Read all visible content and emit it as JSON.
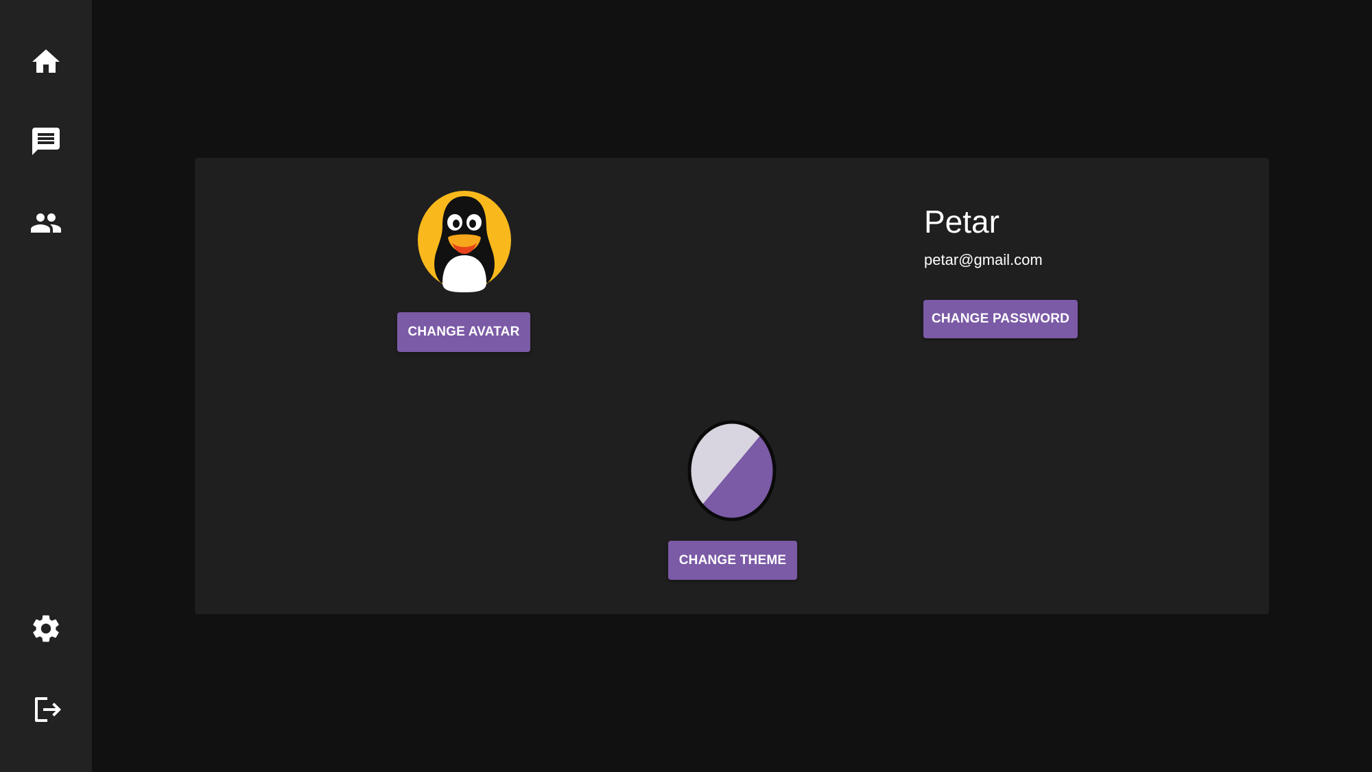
{
  "sidebar": {
    "items": [
      {
        "name": "home",
        "icon": "home-icon"
      },
      {
        "name": "chat",
        "icon": "chat-icon"
      },
      {
        "name": "friends",
        "icon": "people-icon"
      },
      {
        "name": "settings",
        "icon": "gear-icon"
      },
      {
        "name": "logout",
        "icon": "logout-icon"
      }
    ]
  },
  "profile": {
    "username": "Petar",
    "email": "petar@gmail.com",
    "avatar_icon": "penguin-avatar",
    "change_avatar_label": "CHANGE AVATAR",
    "change_password_label": "CHANGE PASSWORD",
    "change_theme_label": "CHANGE THEME"
  },
  "colors": {
    "background": "#111111",
    "sidebar": "#222222",
    "card": "#1f1f1f",
    "accent": "#7b5aa6",
    "theme_light": "#d9d5e0",
    "theme_dark": "#7b5aa6"
  }
}
